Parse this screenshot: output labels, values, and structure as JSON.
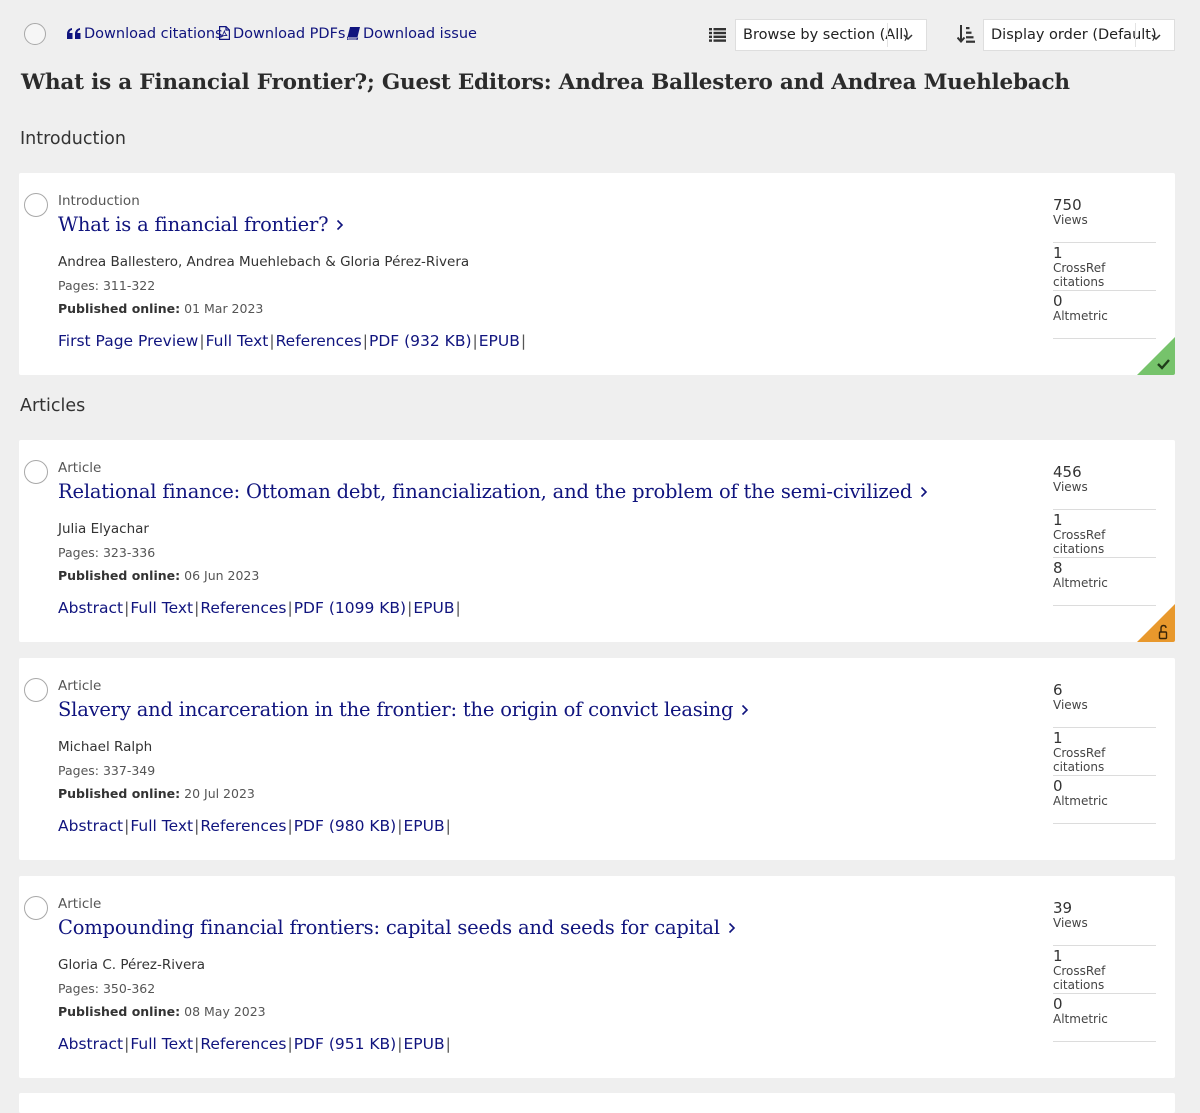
{
  "toolbar": {
    "download_citations": "Download citations",
    "download_pdfs": "Download PDFs",
    "download_issue": "Download issue",
    "browse_by_section": "Browse by section (All)",
    "display_order": "Display order (Default)"
  },
  "issue_title": "What is a Financial Frontier?; Guest Editors: Andrea Ballestero and Andrea Muehlebach",
  "sections": {
    "introduction": "Introduction",
    "articles": "Articles"
  },
  "labels": {
    "pages": "Pages:",
    "published_online": "Published online:",
    "views": "Views",
    "crossref": "CrossRef citations",
    "altmetric": "Altmetric"
  },
  "colors": {
    "link": "#10147e",
    "free_access_badge": "#76c36b",
    "open_access_badge": "#e8982c"
  },
  "articles": [
    {
      "type": "Introduction",
      "title": "What is a financial frontier?",
      "authors": "Andrea Ballestero, Andrea Muehlebach & Gloria Pérez-Rivera",
      "pages": "311-322",
      "published": "01 Mar 2023",
      "links": [
        "First Page Preview",
        "Full Text",
        "References",
        "PDF (932 KB)",
        "EPUB"
      ],
      "views": "750",
      "crossref": "1",
      "altmetric": "0",
      "badge": "check-icon"
    },
    {
      "type": "Article",
      "title": "Relational finance: Ottoman debt, financialization, and the problem of the semi-civilized",
      "authors": "Julia Elyachar",
      "pages": "323-336",
      "published": "06 Jun 2023",
      "links": [
        "Abstract",
        "Full Text",
        "References",
        "PDF (1099 KB)",
        "EPUB"
      ],
      "views": "456",
      "crossref": "1",
      "altmetric": "8",
      "badge": "open-lock-icon"
    },
    {
      "type": "Article",
      "title": "Slavery and incarceration in the frontier: the origin of convict leasing",
      "authors": "Michael Ralph",
      "pages": "337-349",
      "published": "20 Jul 2023",
      "links": [
        "Abstract",
        "Full Text",
        "References",
        "PDF (980 KB)",
        "EPUB"
      ],
      "views": "6",
      "crossref": "1",
      "altmetric": "0"
    },
    {
      "type": "Article",
      "title": "Compounding financial frontiers: capital seeds and seeds for capital",
      "authors": "Gloria C. Pérez-Rivera",
      "pages": "350-362",
      "published": "08 May 2023",
      "links": [
        "Abstract",
        "Full Text",
        "References",
        "PDF (951 KB)",
        "EPUB"
      ],
      "views": "39",
      "crossref": "1",
      "altmetric": "0"
    }
  ]
}
